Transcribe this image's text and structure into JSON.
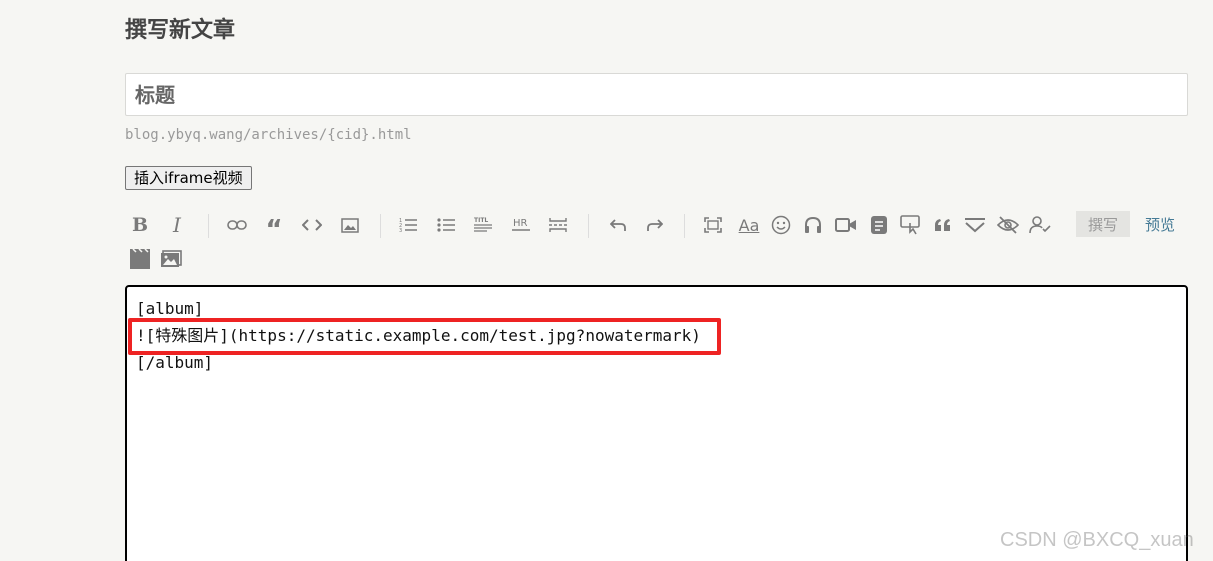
{
  "page": {
    "title": "撰写新文章"
  },
  "title_field": {
    "placeholder": "标题",
    "value": ""
  },
  "slug": {
    "text": "blog.ybyq.wang/archives/{cid}.html"
  },
  "iframe_button": {
    "label": "插入iframe视频"
  },
  "toolbar": {
    "icons": [
      "bold-icon",
      "italic-icon",
      "link-icon",
      "quote-icon",
      "code-icon",
      "image-icon",
      "ordered-list-icon",
      "unordered-list-icon",
      "title-icon",
      "hr-icon",
      "more-icon",
      "undo-icon",
      "redo-icon",
      "fullscreen-icon",
      "text-style-icon",
      "emoji-icon",
      "audio-icon",
      "video-icon",
      "note-icon",
      "tooltip-icon",
      "blockquote-icon",
      "collapse-icon",
      "hide-icon",
      "reply-visible-icon",
      "album-icon",
      "gallery-icon"
    ],
    "bold_label": "B",
    "italic_label": "I",
    "hr_label": "HR",
    "text_style_label": "Aa",
    "quote_label": "“",
    "tabs": {
      "write": "撰写",
      "preview": "预览"
    }
  },
  "editor": {
    "lines": [
      "[album]",
      "![特殊图片](https://static.example.com/test.jpg?nowatermark)",
      "[/album]"
    ]
  },
  "watermark": {
    "text": "CSDN @BXCQ_xuan"
  },
  "colors": {
    "highlight": "#ee2323",
    "link": "#467b96",
    "background": "#f6f6f3"
  }
}
